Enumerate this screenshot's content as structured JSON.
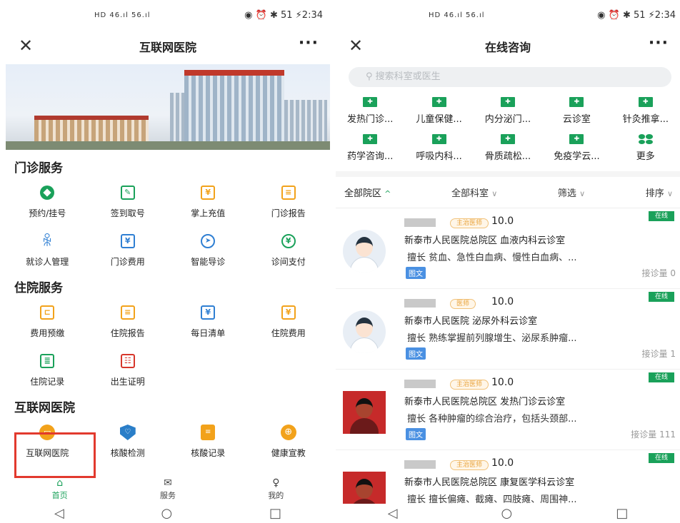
{
  "status_bar": {
    "left_signal": "HD  46.ıl  56.ıl",
    "right": "◉ ⏰ ✱ 51 ⚡2:34"
  },
  "left": {
    "nav_title": "互联网医院",
    "sections": [
      {
        "title": "门诊服务",
        "items": [
          {
            "label": "预约/挂号",
            "icon": "appointment-icon"
          },
          {
            "label": "签到取号",
            "icon": "checkin-icon"
          },
          {
            "label": "掌上充值",
            "icon": "recharge-icon"
          },
          {
            "label": "门诊报告",
            "icon": "report-icon"
          },
          {
            "label": "就诊人管理",
            "icon": "patient-icon"
          },
          {
            "label": "门诊费用",
            "icon": "fee-icon"
          },
          {
            "label": "智能导诊",
            "icon": "guide-icon"
          },
          {
            "label": "诊间支付",
            "icon": "pay-icon"
          }
        ]
      },
      {
        "title": "住院服务",
        "items": [
          {
            "label": "费用预缴",
            "icon": "prepay-icon"
          },
          {
            "label": "住院报告",
            "icon": "inpatient-report-icon"
          },
          {
            "label": "每日清单",
            "icon": "daily-list-icon"
          },
          {
            "label": "住院费用",
            "icon": "inpatient-fee-icon"
          },
          {
            "label": "住院记录",
            "icon": "record-icon"
          },
          {
            "label": "出生证明",
            "icon": "birth-certificate-icon"
          }
        ]
      },
      {
        "title": "互联网医院",
        "items": [
          {
            "label": "互联网医院",
            "icon": "internet-hospital-icon"
          },
          {
            "label": "核酸检测",
            "icon": "nucleic-test-icon"
          },
          {
            "label": "核酸记录",
            "icon": "nucleic-record-icon"
          },
          {
            "label": "健康宣教",
            "icon": "health-edu-icon"
          }
        ]
      }
    ],
    "tabbar": [
      {
        "label": "首页",
        "icon": "home-icon",
        "active": true
      },
      {
        "label": "服务",
        "icon": "mail-icon",
        "active": false
      },
      {
        "label": "我的",
        "icon": "user-icon",
        "active": false
      }
    ]
  },
  "right": {
    "nav_title": "在线咨询",
    "search_placeholder": "搜索科室或医生",
    "categories": [
      "发热门诊...",
      "儿童保健...",
      "内分泌门...",
      "云诊室",
      "针灸推拿...",
      "药学咨询...",
      "呼吸内科...",
      "骨质疏松...",
      "免疫学云...",
      "更多"
    ],
    "filters": [
      {
        "label": "全部院区",
        "arrow": "^"
      },
      {
        "label": "全部科室",
        "arrow": "∨"
      },
      {
        "label": "筛选",
        "arrow": "∨"
      },
      {
        "label": "排序",
        "arrow": "∨"
      }
    ],
    "doctors": [
      {
        "badge": "在线",
        "rank": "主治医师",
        "score": "10.0",
        "dept": "新泰市人民医院总院区 血液内科云诊室",
        "spec": "擅长  贫血、急性白血病、慢性白血病、...",
        "tag": "图文",
        "count": "接诊量 0",
        "photo": false
      },
      {
        "badge": "在线",
        "rank": "医师",
        "score": "10.0",
        "dept": "新泰市人民医院 泌尿外科云诊室",
        "spec": "擅长  熟练掌握前列腺增生、泌尿系肿瘤...",
        "tag": "图文",
        "count": "接诊量 1",
        "photo": false
      },
      {
        "badge": "在线",
        "rank": "主治医师",
        "score": "10.0",
        "dept": "新泰市人民医院总院区 发热门诊云诊室",
        "spec": "擅长  各种肿瘤的综合治疗，包括头颈部...",
        "tag": "图文",
        "count": "接诊量 111",
        "photo": true
      },
      {
        "badge": "在线",
        "rank": "主治医师",
        "score": "10.0",
        "dept": "新泰市人民医院总院区 康复医学科云诊室",
        "spec": "擅长  擅长偏瘫、截瘫、四肢瘫、周围神...",
        "tag": "",
        "count": "",
        "photo": true
      }
    ]
  },
  "sysbar": [
    "◁",
    "○",
    "□"
  ]
}
